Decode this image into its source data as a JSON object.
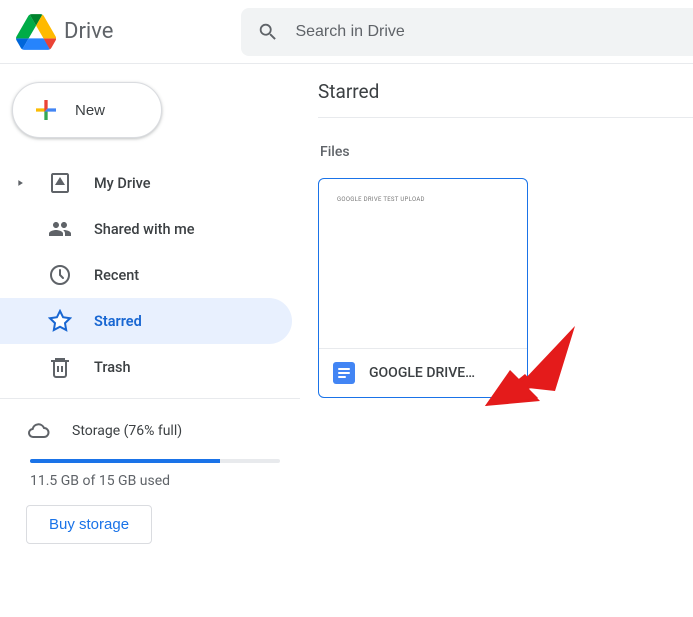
{
  "brand": "Drive",
  "search": {
    "placeholder": "Search in Drive"
  },
  "new_button": {
    "label": "New"
  },
  "nav": {
    "my_drive": "My Drive",
    "shared": "Shared with me",
    "recent": "Recent",
    "starred": "Starred",
    "trash": "Trash"
  },
  "storage": {
    "label": "Storage (76% full)",
    "percent": 76,
    "used_text": "11.5 GB of 15 GB used",
    "buy_label": "Buy storage"
  },
  "main": {
    "title": "Starred",
    "section": "Files",
    "files": [
      {
        "name": "GOOGLE DRIVE…",
        "preview": "GOOGLE DRIVE TEST UPLOAD"
      }
    ]
  }
}
